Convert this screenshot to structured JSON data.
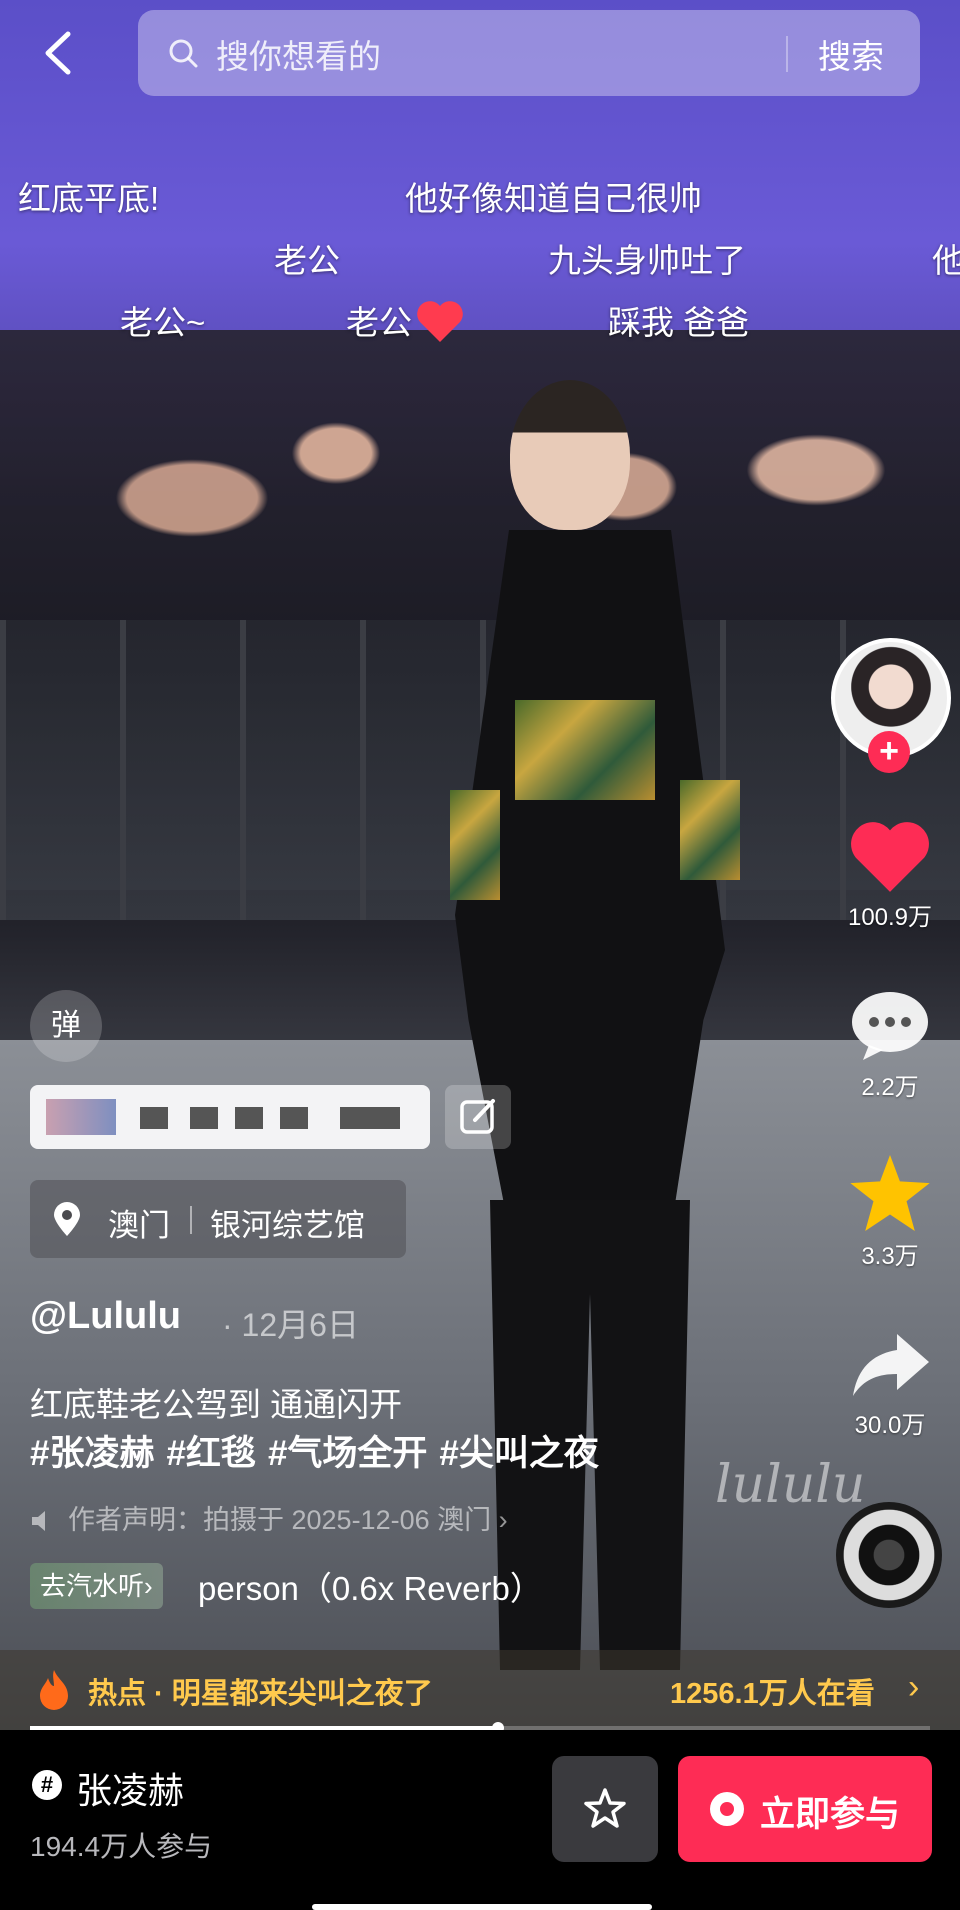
{
  "search": {
    "placeholder": "搜你想看的",
    "button": "搜索"
  },
  "danmaku": [
    "红底平底!",
    "他好像知道自己很帅",
    "老公",
    "九头身帅吐了",
    "他",
    "老公~",
    "老公",
    "踩我 爸爸"
  ],
  "danmaku_toggle": "弹",
  "right_rail": {
    "likes": "100.9万",
    "comments": "2.2万",
    "favorites": "3.3万",
    "shares": "30.0万",
    "follow_glyph": "+"
  },
  "location": {
    "city": "澳门",
    "venue": "银河综艺馆"
  },
  "post": {
    "author": "@Lululu",
    "date": "· 12月6日",
    "description": "红底鞋老公驾到 通通闪开",
    "hashtags": [
      "#张凌赫",
      "#红毯",
      "#气场全开",
      "#尖叫之夜"
    ],
    "declaration": "作者声明：拍摄于 2025-12-06 澳门",
    "declaration_chevron": "›",
    "music_tag": "去汽水听",
    "music_tag_chevron": "›",
    "music_name": "person（0.6x Reverb）",
    "watermark": "lululu"
  },
  "hot_bar": {
    "text": "热点 · 明星都来尖叫之夜了",
    "viewers": "1256.1万人在看",
    "chevron": "›"
  },
  "progress": {
    "fraction": 0.52
  },
  "bottom": {
    "topic_glyph": "#",
    "topic_name": "张凌赫",
    "topic_participants": "194.4万人参与",
    "join_label": "立即参与"
  },
  "colors": {
    "accent": "#fe2c55",
    "hot": "#ffc94d",
    "like": "#fe2c55",
    "star": "#ffc300"
  }
}
